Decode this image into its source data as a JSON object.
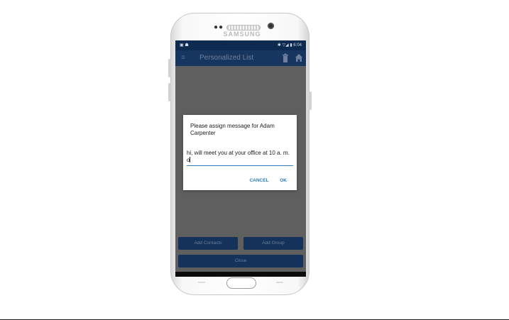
{
  "device": {
    "brand": "SAMSUNG",
    "front_dots": "●●"
  },
  "statusbar": {
    "left_icons": "▣ ☗",
    "right_text": "✱ ▽◢ ▮ 6:04"
  },
  "appbar": {
    "menu_icon": "≡",
    "title": "Personalized List"
  },
  "buttons": {
    "add_contacts": "Add Contacts",
    "add_group": "Add Group",
    "close": "Close"
  },
  "dialog": {
    "title": "Please assign message for Adam Carpenter",
    "input_value": "hi, will meet you at your office at 10 a. m. o",
    "cancel": "CANCEL",
    "ok": "OK"
  },
  "navbar": {
    "back": "◁",
    "home": "○",
    "recents": "□"
  },
  "colors": {
    "appbar": "#17365f",
    "statusbar": "#0d2a50",
    "accent": "#2e7cb8",
    "scrim": "#5f5f5f"
  }
}
